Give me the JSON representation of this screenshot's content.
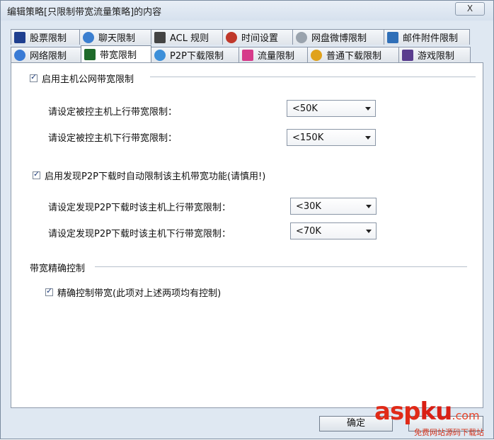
{
  "window": {
    "title": "编辑策略[只限制带宽流量策略]的内容",
    "close_label": "X"
  },
  "tabs_row1": [
    {
      "label": "股票限制",
      "icon": "stock-chart-icon",
      "color": "#1f3f8f"
    },
    {
      "label": "聊天限制",
      "icon": "chat-users-icon",
      "color": "#3b7fd0"
    },
    {
      "label": "ACL 规则",
      "icon": "acl-pen-icon",
      "color": "#444444"
    },
    {
      "label": "时间设置",
      "icon": "clock-red-icon",
      "color": "#c0382b"
    },
    {
      "label": "网盘微博限制",
      "icon": "cloud-drive-icon",
      "color": "#9aa3ad"
    },
    {
      "label": "邮件附件限制",
      "icon": "mail-attachment-icon",
      "color": "#2f6fb8"
    }
  ],
  "tabs_row2": [
    {
      "label": "网络限制",
      "icon": "globe-icon",
      "color": "#3a7bd5",
      "active": false
    },
    {
      "label": "带宽限制",
      "icon": "bandwidth-monitor-icon",
      "color": "#1f6b2a",
      "active": true
    },
    {
      "label": "P2P下载限制",
      "icon": "p2p-icon",
      "color": "#3c8fd9",
      "active": false
    },
    {
      "label": "流量限制",
      "icon": "traffic-bars-icon",
      "color": "#d63b8a",
      "active": false
    },
    {
      "label": "普通下载限制",
      "icon": "download-timer-icon",
      "color": "#e0a21c",
      "active": false
    },
    {
      "label": "游戏限制",
      "icon": "game-icon",
      "color": "#5a3d8e",
      "active": false
    }
  ],
  "main": {
    "public_bw_enabled_label": "启用主机公网带宽限制",
    "upload_limit_label": "请设定被控主机上行带宽限制：",
    "upload_limit_value": "<50K",
    "download_limit_label": "请设定被控主机下行带宽限制：",
    "download_limit_value": "<150K",
    "p2p_auto_label": "启用发现P2P下载时自动限制该主机带宽功能(请慎用!)",
    "p2p_upload_label": "请设定发现P2P下载时该主机上行带宽限制：",
    "p2p_upload_value": "<30K",
    "p2p_download_label": "请设定发现P2P下载时该主机下行带宽限制：",
    "p2p_download_value": "<70K",
    "precise_group_title": "带宽精确控制",
    "precise_label": "精确控制带宽(此项对上述两项均有控制)"
  },
  "footer": {
    "ok_label": "确定"
  },
  "watermark": {
    "text_asp": "asp",
    "text_ku": "ku",
    "text_com": ".com",
    "subtext": "免费网站源码下载站"
  }
}
